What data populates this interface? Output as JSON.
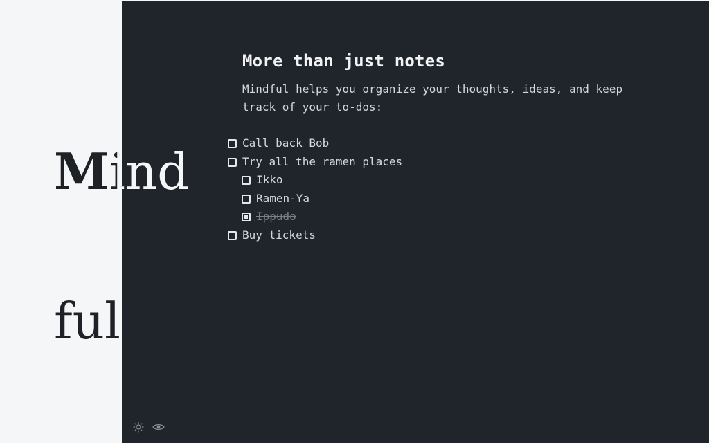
{
  "brand": {
    "line1_m": "M",
    "line1_i": "i",
    "line1_rest": "nd",
    "line2": "ful"
  },
  "content": {
    "heading": "More than just notes",
    "intro": "Mindful helps you organize your thoughts, ideas, and keep track of your to-dos:"
  },
  "todos": [
    {
      "label": "Call back Bob",
      "checked": false
    },
    {
      "label": "Try all the ramen places",
      "checked": false,
      "children": [
        {
          "label": "Ikko",
          "checked": false
        },
        {
          "label": "Ramen-Ya",
          "checked": false
        },
        {
          "label": "Ippudo",
          "checked": true
        }
      ]
    },
    {
      "label": "Buy tickets",
      "checked": false
    }
  ],
  "footer": {
    "icons": [
      "sun-icon",
      "eye-icon"
    ]
  },
  "colors": {
    "brand_bg": "#f5f6f7",
    "editor_bg": "#20242b",
    "text": "#d5d7da",
    "heading": "#f1f2f4",
    "muted": "#7b7f86"
  }
}
